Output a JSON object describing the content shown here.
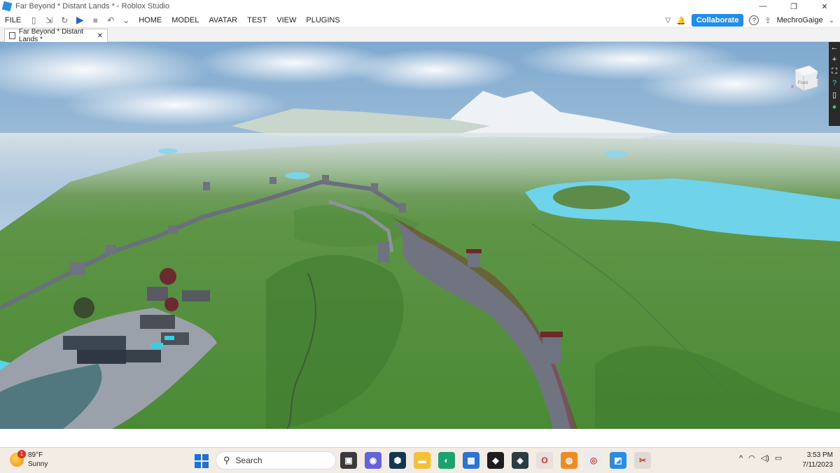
{
  "window": {
    "title": "Far Beyond * Distant Lands * - Roblox Studio",
    "minimize": "—",
    "restore": "❐",
    "close": "✕"
  },
  "menubar": {
    "file": "FILE",
    "home": "HOME",
    "model": "MODEL",
    "avatar": "AVATAR",
    "test": "TEST",
    "view": "VIEW",
    "plugins": "PLUGINS",
    "collaborate": "Collaborate",
    "username": "MechroGaige",
    "help": "?"
  },
  "tab": {
    "label": "Far Beyond * Distant Lands *",
    "close": "✕"
  },
  "viewport": {
    "viewcube_face": "Front",
    "side_tools": [
      "←",
      "+",
      "⛶",
      "?",
      "▯",
      "●"
    ]
  },
  "taskbar": {
    "weather_temp": "89°F",
    "weather_cond": "Sunny",
    "weather_badge": "1",
    "search_placeholder": "Search",
    "time": "3:53 PM",
    "date": "7/11/2023",
    "tray_chevron": "^"
  }
}
